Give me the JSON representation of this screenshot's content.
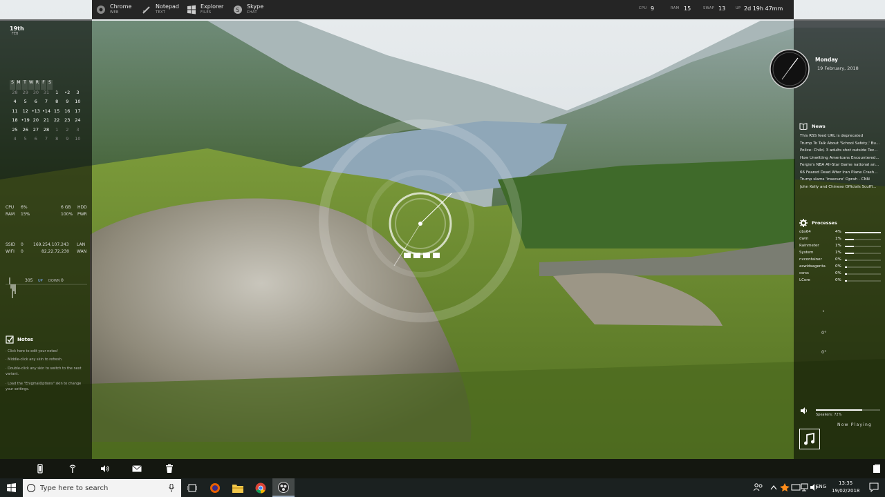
{
  "launcher": [
    {
      "name": "Chrome",
      "sub": "WEB"
    },
    {
      "name": "Notepad",
      "sub": "TEXT"
    },
    {
      "name": "Explorer",
      "sub": "FILES"
    },
    {
      "name": "Skype",
      "sub": "CHAT"
    }
  ],
  "system_stats": {
    "cpu_label": "CPU",
    "cpu": "9",
    "ram_label": "RAM",
    "ram": "15",
    "swap_label": "SWAP",
    "swap": "13",
    "up_label": "UP",
    "uptime": "2d 19h 47mm"
  },
  "date_widget": {
    "day": "19th",
    "month": "FEB"
  },
  "calendar": {
    "headers": [
      "S",
      "M",
      "T",
      "W",
      "R",
      "F",
      "S"
    ],
    "weeks": [
      [
        "28",
        "29",
        "30",
        "31",
        "1",
        "•2",
        "3"
      ],
      [
        "4",
        "5",
        "6",
        "7",
        "8",
        "9",
        "10"
      ],
      [
        "11",
        "12",
        "•13",
        "•14",
        "15",
        "16",
        "17"
      ],
      [
        "18",
        "•19",
        "20",
        "21",
        "22",
        "23",
        "24"
      ],
      [
        "25",
        "26",
        "27",
        "28",
        "1",
        "2",
        "3"
      ],
      [
        "4",
        "5",
        "6",
        "7",
        "8",
        "9",
        "10"
      ]
    ]
  },
  "hw": {
    "cpu_label": "CPU",
    "cpu": "6%",
    "ram_label": "RAM",
    "ram": "15%",
    "hdd_val": "6 GB",
    "hdd_label": "HDD",
    "pwr_val": "100%",
    "pwr_label": "PWR"
  },
  "net": {
    "ssid_label": "SSID",
    "ssid": "0",
    "wifi_label": "WIFI",
    "wifi": "0",
    "lan_ip": "169.254.107.243",
    "lan_label": "LAN",
    "wan_ip": "82.22.72.230",
    "wan_label": "WAN",
    "up_val": "305",
    "up_label": "UP",
    "down_label": "DOWN",
    "down_val": "0"
  },
  "notes": {
    "title": "Notes",
    "lines": [
      "· Click here to edit your notes!",
      "· Middle-click any skin to refresh.",
      "· Double-click any skin to switch to the next variant.",
      "· Load the \"Enigma\\Options\" skin to change your settings."
    ]
  },
  "clock": {
    "weekday": "Monday",
    "date": "19 February, 2018"
  },
  "news": {
    "title": "News",
    "items": [
      "This RSS feed URL is deprecated",
      "Trump To Talk About 'School Safety,' Bu...",
      "Police: Child, 3 adults shot outside Tex...",
      "How Unwitting Americans Encountered...",
      "Fergie's NBA All-Star Game national an...",
      "66 Feared Dead After Iran Plane Crash...",
      "Trump slams 'insecure' Oprah - CNN",
      "John Kelly and Chinese Officials Scuffl..."
    ]
  },
  "processes": {
    "title": "Processes",
    "items": [
      {
        "name": "obs64",
        "value": "4%",
        "frac": 1.0
      },
      {
        "name": "dwm",
        "value": "1%",
        "frac": 0.25
      },
      {
        "name": "Rainmeter",
        "value": "1%",
        "frac": 0.25
      },
      {
        "name": "System",
        "value": "1%",
        "frac": 0.25
      },
      {
        "name": "nvcontainer",
        "value": "0%",
        "frac": 0.05
      },
      {
        "name": "aswidsagenta",
        "value": "0%",
        "frac": 0.05
      },
      {
        "name": "csrss",
        "value": "0%",
        "frac": 0.05
      },
      {
        "name": "LCore",
        "value": "0%",
        "frac": 0.05
      }
    ]
  },
  "weather": {
    "bullet": "•",
    "temp1": "0°",
    "temp2": "0°"
  },
  "audio": {
    "device": "Speakers:",
    "volume": "72%",
    "volume_frac": 0.72,
    "now_playing": "Now Playing"
  },
  "search": {
    "placeholder": "Type here to search"
  },
  "tray": {
    "lang": "ENG",
    "time": "13:35",
    "date": "19/02/2018"
  },
  "colors": {
    "panel": "#000000",
    "accent": "#ffffff",
    "taskbar": "#1a1f22"
  }
}
